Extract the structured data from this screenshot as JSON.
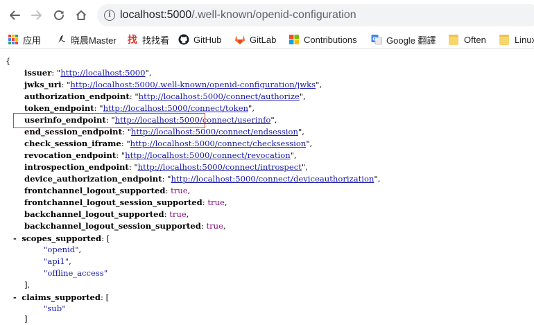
{
  "browser": {
    "url_host": "localhost:5000",
    "url_path": "/.well-known/openid-configuration"
  },
  "bookmarks": [
    {
      "label": "应用",
      "icon": "apps-grid-icon"
    },
    {
      "label": "晓晨Master",
      "icon": "blog-icon"
    },
    {
      "label": "找找看",
      "icon": "search-site-icon"
    },
    {
      "label": "GitHub",
      "icon": "github-icon"
    },
    {
      "label": "GitLab",
      "icon": "gitlab-icon"
    },
    {
      "label": "Contributions",
      "icon": "windows-icon"
    },
    {
      "label": "Google 翻譯",
      "icon": "translate-icon"
    },
    {
      "label": "Often",
      "icon": "folder-icon"
    },
    {
      "label": "Linux",
      "icon": "folder-icon"
    }
  ],
  "json": {
    "open_brace": "{",
    "issuer": {
      "key": "issuer",
      "value": "http://localhost:5000"
    },
    "jwks_uri": {
      "key": "jwks_uri",
      "value": "http://localhost:5000/.well-known/openid-configuration/jwks"
    },
    "authorization_endpoint": {
      "key": "authorization_endpoint",
      "value": "http://localhost:5000/connect/authorize"
    },
    "token_endpoint": {
      "key": "token_endpoint",
      "value": "http://localhost:5000/connect/token"
    },
    "userinfo_endpoint": {
      "key": "userinfo_endpoint",
      "value": "http://localhost:5000/connect/userinfo"
    },
    "end_session_endpoint": {
      "key": "end_session_endpoint",
      "value": "http://localhost:5000/connect/endsession"
    },
    "check_session_iframe": {
      "key": "check_session_iframe",
      "value": "http://localhost:5000/connect/checksession"
    },
    "revocation_endpoint": {
      "key": "revocation_endpoint",
      "value": "http://localhost:5000/connect/revocation"
    },
    "introspection_endpoint": {
      "key": "introspection_endpoint",
      "value": "http://localhost:5000/connect/introspect"
    },
    "device_authorization_endpoint": {
      "key": "device_authorization_endpoint",
      "value": "http://localhost:5000/connect/deviceauthorization"
    },
    "frontchannel_logout_supported": {
      "key": "frontchannel_logout_supported",
      "value": "true"
    },
    "frontchannel_logout_session_supported": {
      "key": "frontchannel_logout_session_supported",
      "value": "true"
    },
    "backchannel_logout_supported": {
      "key": "backchannel_logout_supported",
      "value": "true"
    },
    "backchannel_logout_session_supported": {
      "key": "backchannel_logout_session_supported",
      "value": "true"
    },
    "scopes_supported": {
      "key": "scopes_supported",
      "values": [
        "openid",
        "api1",
        "offline_access"
      ]
    },
    "claims_supported": {
      "key": "claims_supported",
      "values": [
        "sub"
      ]
    },
    "collapse_symbol": "-"
  },
  "colors": {
    "highlight_border": "#e0383e",
    "string": "#1a1aa6",
    "boolean": "#881280"
  }
}
